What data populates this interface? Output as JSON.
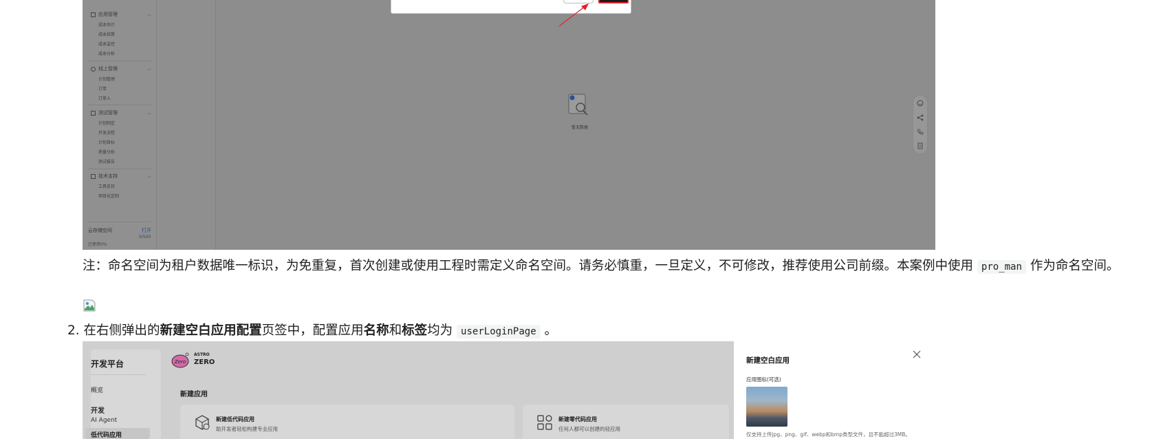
{
  "screenshot1": {
    "sidebar_groups": [
      {
        "label": "应用管理",
        "items": [
          "成本估计",
          "成本核算",
          "成本监控",
          "成本分析"
        ]
      },
      {
        "label": "线上管理",
        "items": [
          "计划管理",
          "订单",
          "订单入"
        ]
      },
      {
        "label": "测试管理",
        "items": [
          "计划制定",
          "开发流程",
          "计划目标",
          "质量分析",
          "测试报告"
        ]
      },
      {
        "label": "技术支持",
        "items": [
          "工具支持",
          "项目化定制"
        ]
      }
    ],
    "storage": {
      "label": "云存储空间",
      "open_link": "打开",
      "count": "0/500",
      "used": "已使用0%"
    },
    "empty_state_text": "暂无数据"
  },
  "note": {
    "prefix": "注：命名空间为租户数据唯一标识，为免重复，首次创建或使用工程时需定义命名空间。请务必慎重，一旦定义，不可修改，推荐使用公司前缀。本案例中使用",
    "code": "pro_man",
    "suffix": "作为命名空间。"
  },
  "step2": {
    "number": "2.",
    "t1": "在右侧弹出的",
    "b1": "新建空白应用配置",
    "t2": "页签中，配置应用",
    "b2": "名称",
    "t3": "和",
    "b3": "标签",
    "t4": "均为",
    "code": "userLoginPage",
    "t5": "。"
  },
  "screenshot2": {
    "nav": {
      "title": "开发平台",
      "items": [
        "概览",
        "开发",
        "AI Agent",
        "低代码应用"
      ]
    },
    "logo": {
      "line1": "ASTRO",
      "line2": "ZERO",
      "badge": "Zero"
    },
    "main_title": "新建应用",
    "cards": [
      {
        "title": "新建低代码应用",
        "desc": "助开发者轻松构建专业应用"
      },
      {
        "title": "新建零代码应用",
        "desc": "任何人都可以创建的轻应用"
      }
    ],
    "panel": {
      "title": "新建空白应用",
      "icon_label": "应用图标(可选)",
      "tip": "仅支持上传jpg、png、gif、webp和bmp类型文件，且不能超过3MB。"
    }
  }
}
